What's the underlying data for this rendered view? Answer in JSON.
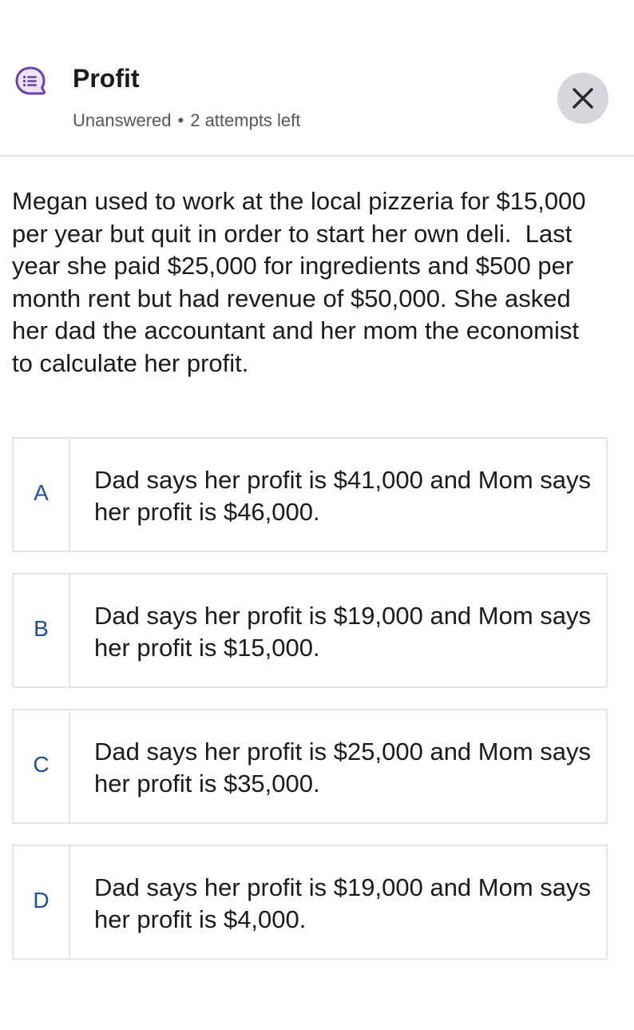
{
  "header": {
    "icon": "speech-bubble-list-icon",
    "title": "Profit",
    "status": "Unanswered",
    "separator": "•",
    "attempts": "2 attempts left",
    "close_icon": "close-icon"
  },
  "question": {
    "text": "Megan used to work at the local pizzeria for $15,000 per year but quit in order to start her own deli.  Last year she paid $25,000 for ingredients and $500 per month rent but had revenue of $50,000. She asked her dad the accountant and her mom the economist to calculate her profit."
  },
  "options": [
    {
      "letter": "A",
      "text": "Dad says her profit is $41,000 and Mom says her profit is $46,000."
    },
    {
      "letter": "B",
      "text": "Dad says her profit is $19,000 and Mom says her profit is $15,000."
    },
    {
      "letter": "C",
      "text": "Dad says her profit is $25,000 and Mom says her profit is $35,000."
    },
    {
      "letter": "D",
      "text": "Dad says her profit is $19,000 and Mom says her profit is $4,000."
    }
  ],
  "colors": {
    "accent_purple": "#6b3fb0",
    "letter_blue": "#1e4fa3",
    "close_bg": "#d5d7dc"
  }
}
